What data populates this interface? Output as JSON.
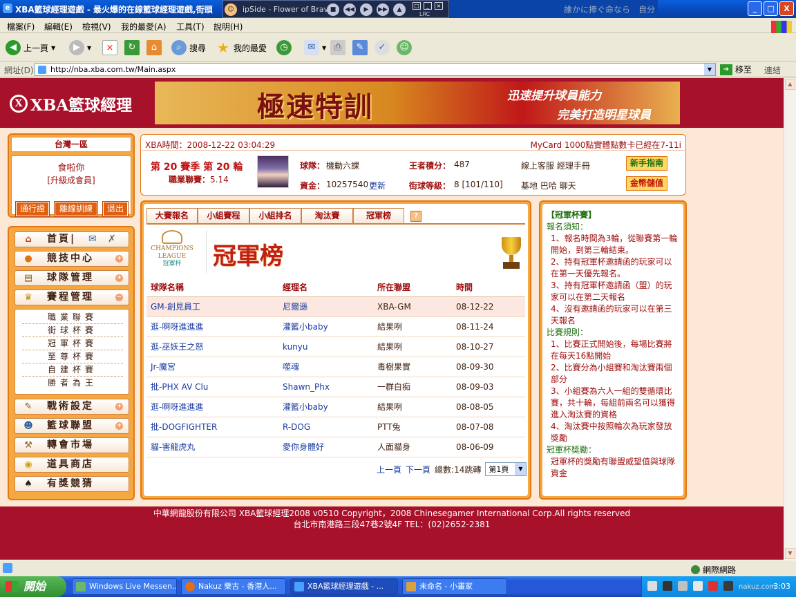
{
  "window": {
    "title": "XBA籃球經理遊戲 - 最火爆的在線籃球經理遊戲,街頭",
    "min": "_",
    "max": "□",
    "close": "X"
  },
  "media": {
    "song": "ipSide - Flower of Brave",
    "lrc": "LRC",
    "lyric": "誰かに捧ぐ命なら　自分"
  },
  "menu": [
    "檔案(F)",
    "編輯(E)",
    "檢視(V)",
    "我的最愛(A)",
    "工具(T)",
    "說明(H)"
  ],
  "toolbar": {
    "back": "上一頁",
    "search": "搜尋",
    "favorites": "我的最愛"
  },
  "address": {
    "label": "網址(D)",
    "url": "http://nba.xba.com.tw/Main.aspx",
    "go": "移至",
    "links": "連結"
  },
  "header": {
    "logo": "XBA籃球經理",
    "banner_title": "極速特訓",
    "banner_line1": "迅速提升球員能力",
    "banner_line2": "完美打造明星球員"
  },
  "user": {
    "zone": "台灣一區",
    "name": "食啦你",
    "level": "[升級成會員]",
    "buttons": [
      "通行證",
      "離線訓練",
      "退出"
    ]
  },
  "nav": {
    "items": [
      "首頁|",
      "競技中心",
      "球隊管理",
      "賽程管理",
      "戰術設定",
      "籃球聯盟",
      "轉會市場",
      "道具商店",
      "有獎競猜"
    ],
    "sub": [
      "職業聯賽",
      "街球杯賽",
      "冠軍杯賽",
      "至尊杯賽",
      "自建杯賽",
      "勝者為王"
    ]
  },
  "info": {
    "time": "XBA時間：2008-12-22 03:04:29",
    "mycard": "MyCard 1000點實體點數卡已經在7-11i",
    "season": "第 20 賽季  第 20 輪",
    "pro_label": "職業聯賽：",
    "pro_value": "5.14",
    "team_label": "球隊：",
    "team_value": "機動六課",
    "score_label": "王者積分：",
    "score_value": "487",
    "money_label": "資金：",
    "money_value": "10257540",
    "update": "更新",
    "street_label": "街球等級：",
    "street_value": "8 [101/110]",
    "links1": "線上客服  經理手冊",
    "links2": "基地  巴哈  聊天",
    "guide": "新手指南",
    "store": "金幣儲值"
  },
  "tabs": [
    "大賽報名",
    "小組賽程",
    "小組排名",
    "淘汰賽",
    "冠軍榜"
  ],
  "help": "?",
  "main": {
    "title": "冠軍榜",
    "logo_a": "CHAMPIONS",
    "logo_b": "LEAGUE",
    "logo_c": "冠軍杯",
    "headers": [
      "球隊名稱",
      "經理名",
      "所在聯盟",
      "時間"
    ],
    "rows": [
      [
        "GM-創見員工",
        "尼爾遜",
        "XBA-GM",
        "08-12-22"
      ],
      [
        "逛-啊呀進進進",
        "灌籃小baby",
        "結果咧",
        "08-11-24"
      ],
      [
        "逛-巫妖王之怒",
        "kunyu",
        "結果咧",
        "08-10-27"
      ],
      [
        "Jr-魔宮",
        "噬魂",
        "毒樹果實",
        "08-09-30"
      ],
      [
        "批-PHX AV Clu",
        "Shawn_Phx",
        "一群白痴",
        "08-09-03"
      ],
      [
        "逛-啊呀進進進",
        "灌籃小baby",
        "結果咧",
        "08-08-05"
      ],
      [
        "批-DOGFIGHTER",
        "R-DOG",
        "PTT兔",
        "08-07-08"
      ],
      [
        "貓-害龍虎丸",
        "愛你身體好",
        "人面貓身",
        "08-06-09"
      ]
    ],
    "pager": {
      "prev": "上一頁",
      "next": "下一頁",
      "total": "總數:14跳轉",
      "page": "第1頁"
    }
  },
  "rules": {
    "title": "【冠軍杯賽】",
    "s1": "報名須知：",
    "r1": [
      "1、報名時間為3輪，從聯賽第一輪開始，到第三輪結束。",
      "2、持有冠軍杯邀請函的玩家可以在第一天優先報名。",
      "3、持有冠軍杯邀請函（盟）的玩家可以在第二天報名",
      "4、沒有邀請函的玩家可以在第三天報名"
    ],
    "s2": "比賽規則：",
    "r2": [
      "1、比賽正式開始後，每場比賽將在每天16點開始",
      "2、比賽分為小組賽和淘汰賽兩個部分",
      "3、小組賽為六人一組的雙循環比賽，共十輪，每組前兩名可以獲得進入淘汰賽的資格",
      "4、淘汰賽中按照輪次為玩家發放獎勵"
    ],
    "s3": "冠軍杯獎勵：",
    "r3": [
      "冠軍杯的獎勵有聯盟威望值與球隊資金"
    ]
  },
  "footer": {
    "line1": "中華網龍股份有限公司  XBA籃球經理2008 v0510    Copyright，2008 Chinesegamer International Corp.All rights reserved",
    "line2": "台北市南港路三段47巷2號4F TEL：(02)2652-2381"
  },
  "status": {
    "zone": "網際網路"
  },
  "taskbar": {
    "start": "開始",
    "tasks": [
      "Windows Live Messen...",
      "Nakuz 樂古 - 香港人...",
      "XBA籃球經理遊戲 - ...",
      "未命名 - 小畫家"
    ],
    "clock": "3:03",
    "watermark": "nakuz.com"
  }
}
